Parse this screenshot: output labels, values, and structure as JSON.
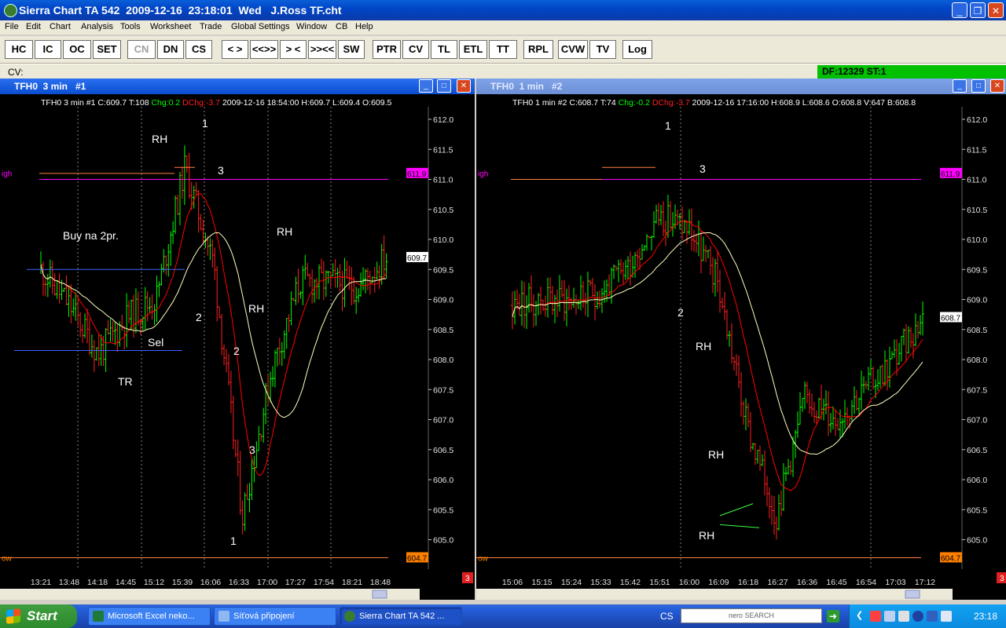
{
  "window": {
    "title": "Sierra Chart TA 542  2009-12-16  23:18:01  Wed   J.Ross TF.cht",
    "min_icon": "minimize-icon",
    "max_icon": "maximize-icon",
    "close_icon": "close-icon"
  },
  "menu": [
    "File",
    "Edit",
    "Chart",
    "Analysis",
    "Tools",
    "Worksheet",
    "Trade",
    "Global Settings",
    "Window",
    "CB",
    "Help"
  ],
  "toolbar": [
    "HC",
    "IC",
    "OC",
    "SET",
    "CN",
    "DN",
    "CS",
    "< >",
    "<<>>",
    "> <",
    ">><<",
    "SW",
    "PTR",
    "CV",
    "TL",
    "ETL",
    "TT",
    "RPL",
    "CVW",
    "TV",
    "Log"
  ],
  "cv_bar": {
    "label": "CV:",
    "status": "DF:12329  ST:1"
  },
  "colors": {
    "up_bar": "#00ff00",
    "down_bar": "#ff2020",
    "ma_red": "#ff0000",
    "ma_yellow": "#ffffc0",
    "high_line": "#ff00ff",
    "level_line": "#ff8040",
    "blue_line": "#4060ff",
    "price_tag": "#ff8000",
    "high_tag": "#ff00ff"
  },
  "chart1": {
    "title": "TFH0  3 min   #1",
    "info": {
      "a": "TFH0  3 min   #1  C:609.7  T:108",
      "chg": "Chg:0.2",
      "dchg": "DChg:-3.7",
      "b": "2009-12-16   18:54:00  H:609.7  L:609.4  O:609.5"
    },
    "high_label": "igh",
    "low_label": "ow",
    "high_tag": "611.9",
    "low_tag": "604.7",
    "last_tag": "609.7",
    "y_ticks": [
      "612.0",
      "611.5",
      "611.0",
      "610.5",
      "610.0",
      "609.5",
      "609.0",
      "608.5",
      "608.0",
      "607.5",
      "607.0",
      "606.5",
      "606.0",
      "605.5",
      "605.0"
    ],
    "x_ticks": [
      "13:21",
      "13:48",
      "14:18",
      "14:45",
      "15:12",
      "15:39",
      "16:06",
      "16:33",
      "17:00",
      "17:27",
      "17:54",
      "18:21",
      "18:48"
    ],
    "annotations": [
      "RH",
      "1",
      "3",
      "Buy na 2pr.",
      "RH",
      "2",
      "RH",
      "Sel",
      "2",
      "TR",
      "3",
      "1"
    ],
    "scroll_badge": "3"
  },
  "chart2": {
    "title": "TFH0  1 min   #2",
    "info": {
      "a": "TFH0  1 min   #2  C:608.7  T:74",
      "chg": "Chg:-0.2",
      "dchg": "DChg:-3.7",
      "b": "2009-12-16   17:16:00  H:608.9  L:608.6  O:608.8  V:647  B:608.8"
    },
    "high_label": "igh",
    "low_label": "ow",
    "high_tag": "611.9",
    "low_tag": "604.7",
    "last_tag": "608.7",
    "y_ticks": [
      "612.0",
      "611.5",
      "611.0",
      "610.5",
      "610.0",
      "609.5",
      "609.0",
      "608.5",
      "608.0",
      "607.5",
      "607.0",
      "606.5",
      "606.0",
      "605.5",
      "605.0"
    ],
    "x_ticks": [
      "15:06",
      "15:15",
      "15:24",
      "15:33",
      "15:42",
      "15:51",
      "16:00",
      "16:09",
      "16:18",
      "16:27",
      "16:36",
      "16:45",
      "16:54",
      "17:03",
      "17:12"
    ],
    "annotations": [
      "1",
      "3",
      "2",
      "RH",
      "RH",
      "RH"
    ],
    "scroll_badge": "3"
  },
  "chart_data": [
    {
      "type": "line",
      "title": "TFH0  3 min   #1",
      "x": [
        "13:21",
        "13:48",
        "14:18",
        "14:45",
        "15:12",
        "15:39",
        "16:06",
        "16:33",
        "17:00",
        "17:27",
        "17:54",
        "18:21",
        "18:48"
      ],
      "series": [
        {
          "values": [
            609.5,
            608.9,
            608.1,
            608.7,
            609.0,
            611.2,
            609.6,
            605.4,
            607.8,
            609.3,
            609.3,
            609.2,
            609.7
          ]
        }
      ],
      "ylim": [
        604.7,
        612.2
      ]
    },
    {
      "type": "line",
      "title": "TFH0  1 min   #2",
      "x": [
        "15:06",
        "15:15",
        "15:24",
        "15:33",
        "15:42",
        "15:51",
        "16:00",
        "16:09",
        "16:18",
        "16:27",
        "16:36",
        "16:45",
        "16:54",
        "17:03",
        "17:12"
      ],
      "series": [
        {
          "values": [
            608.9,
            609.0,
            609.0,
            609.1,
            609.6,
            610.4,
            610.2,
            609.3,
            606.9,
            605.4,
            607.4,
            607.0,
            607.5,
            608.0,
            608.7
          ]
        }
      ],
      "ylim": [
        604.7,
        612.2
      ]
    }
  ],
  "taskbar": {
    "start": "Start",
    "tasks": [
      "Microsoft Excel neko...",
      "Síťová připojení",
      "Sierra Chart TA 542 ..."
    ],
    "lang": "CS",
    "search": "nero SEARCH",
    "clock": "23:18"
  }
}
